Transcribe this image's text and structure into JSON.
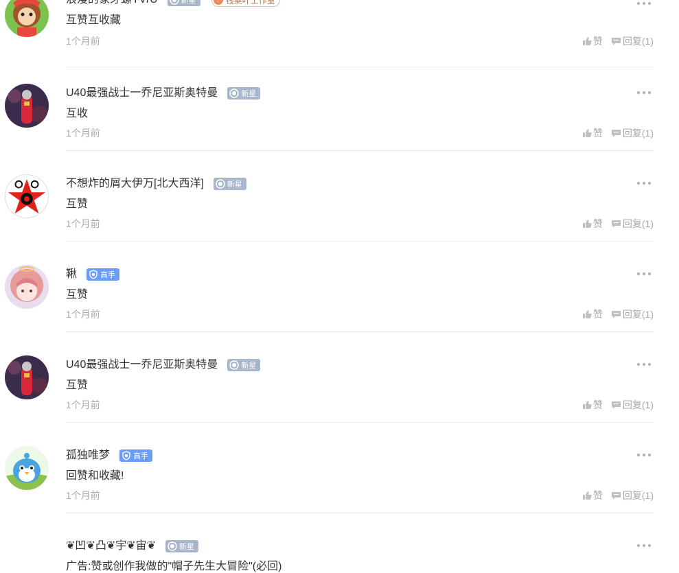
{
  "comments": [
    {
      "username": "浪漫的象牙螺YVrU",
      "level": "新星",
      "studio": "钱桌叶工作室",
      "content": "互赞互收藏",
      "time": "1个月前",
      "like_label": "赞",
      "reply_label": "回复(1)",
      "avatar": "cartoon-monkey-avatar"
    },
    {
      "username": "U40最强战士一乔尼亚斯奥特曼",
      "level": "新星",
      "content": "互收",
      "time": "1个月前",
      "like_label": "赞",
      "reply_label": "回复(1)",
      "avatar": "ultraman-avatar"
    },
    {
      "username": "不想炸的屑大伊万[北大西洋]",
      "level": "新星",
      "content": "互赞",
      "time": "1个月前",
      "like_label": "赞",
      "reply_label": "回复(1)",
      "avatar": "red-star-emblem-avatar"
    },
    {
      "username": "鞦",
      "level": "高手",
      "content": "互赞",
      "time": "1个月前",
      "like_label": "赞",
      "reply_label": "回复(1)",
      "avatar": "anime-girl-avatar"
    },
    {
      "username": "U40最强战士一乔尼亚斯奥特曼",
      "level": "新星",
      "content": "互赞",
      "time": "1个月前",
      "like_label": "赞",
      "reply_label": "回复(1)",
      "avatar": "ultraman-avatar"
    },
    {
      "username": "孤独唯梦",
      "level": "高手",
      "content": "回赞和收藏!",
      "time": "1个月前",
      "like_label": "赞",
      "reply_label": "回复(1)",
      "avatar": "blue-bird-avatar"
    },
    {
      "username": "❦凹❦凸❦宇❦宙❦",
      "level": "新星",
      "content": "广告:赞或创作我做的\"帽子先生大冒险\"(必回)",
      "time": "",
      "like_label": "",
      "reply_label": "",
      "avatar": "none"
    }
  ],
  "colors": {
    "badge_xinxing": "#a8b6cb",
    "badge_gaoshou": "#6a9cf5",
    "meta_text": "#a8a8a8",
    "divider": "#ececec"
  }
}
